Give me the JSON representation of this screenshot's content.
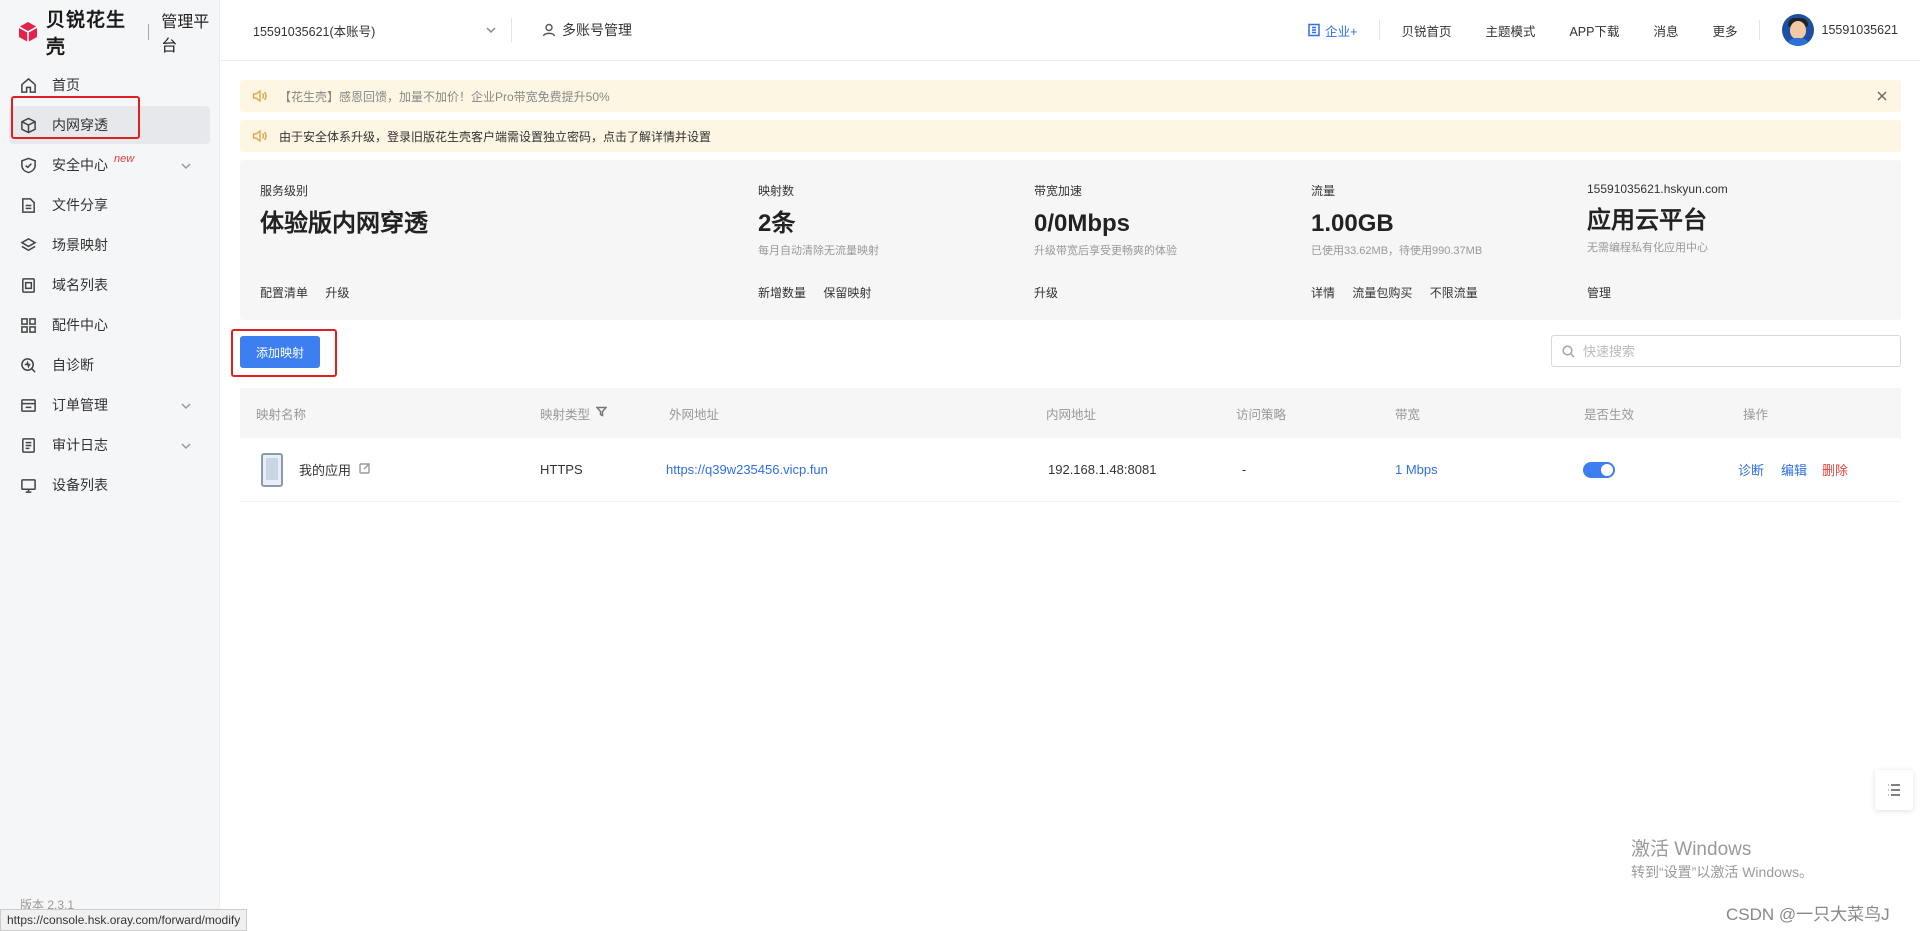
{
  "brand": {
    "name": "贝锐花生壳",
    "subtitle": "管理平台",
    "color": "#e5234a"
  },
  "sidebar": {
    "items": [
      {
        "label": "首页",
        "icon": "home-icon"
      },
      {
        "label": "内网穿透",
        "icon": "cube-icon",
        "active": true
      },
      {
        "label": "安全中心",
        "icon": "shield-icon",
        "tag": "new",
        "expandable": true
      },
      {
        "label": "文件分享",
        "icon": "file-share-icon"
      },
      {
        "label": "场景映射",
        "icon": "layers-icon"
      },
      {
        "label": "域名列表",
        "icon": "domain-icon"
      },
      {
        "label": "配件中心",
        "icon": "grid-icon"
      },
      {
        "label": "自诊断",
        "icon": "diagnose-icon"
      },
      {
        "label": "订单管理",
        "icon": "order-icon",
        "expandable": true
      },
      {
        "label": "审计日志",
        "icon": "log-icon",
        "expandable": true
      },
      {
        "label": "设备列表",
        "icon": "monitor-icon"
      }
    ],
    "version": "版本 2.3.1"
  },
  "header": {
    "account": "15591035621(本账号)",
    "multi_account": "多账号管理",
    "links": {
      "enterprise": "企业+",
      "home": "贝锐首页",
      "theme": "主题模式",
      "app": "APP下载",
      "msg": "消息",
      "more": "更多"
    },
    "user": "15591035621"
  },
  "notices": [
    "【花生壳】感恩回馈，加量不加价！企业Pro带宽免费提升50%",
    "由于安全体系升级，登录旧版花生壳客户端需设置独立密码，点击了解详情并设置"
  ],
  "stats": {
    "service": {
      "label": "服务级别",
      "value": "体验版内网穿透",
      "actions": [
        "配置清单",
        "升级"
      ]
    },
    "mappings": {
      "label": "映射数",
      "value": "2条",
      "sub": "每月自动清除无流量映射",
      "actions": [
        "新增数量",
        "保留映射"
      ]
    },
    "bandwidth": {
      "label": "带宽加速",
      "value": "0/0Mbps",
      "sub": "升级带宽后享受更畅爽的体验",
      "actions": [
        "升级"
      ]
    },
    "traffic": {
      "label": "流量",
      "value": "1.00GB",
      "sub": "已使用33.62MB，待使用990.37MB",
      "actions": [
        "详情",
        "流量包购买",
        "不限流量"
      ]
    },
    "cloud": {
      "label": "15591035621.hskyun.com",
      "value": "应用云平台",
      "sub": "无需编程私有化应用中心",
      "actions": [
        "管理"
      ]
    }
  },
  "toolbar": {
    "add_label": "添加映射",
    "search_placeholder": "快速搜索"
  },
  "table": {
    "headers": [
      "映射名称",
      "映射类型",
      "外网地址",
      "内网地址",
      "访问策略",
      "带宽",
      "是否生效",
      "操作"
    ],
    "rows": [
      {
        "name": "我的应用",
        "type": "HTTPS",
        "public": "https://q39w235456.vicp.fun",
        "private": "192.168.1.48:8081",
        "policy": "-",
        "bandwidth": "1 Mbps",
        "enabled": true,
        "actions": [
          "诊断",
          "编辑",
          "删除"
        ]
      }
    ]
  },
  "status_url": "https://console.hsk.oray.com/forward/modify",
  "watermark": {
    "title": "激活 Windows",
    "sub": "转到“设置”以激活 Windows。"
  },
  "csdn": "CSDN @一只大菜鸟J"
}
